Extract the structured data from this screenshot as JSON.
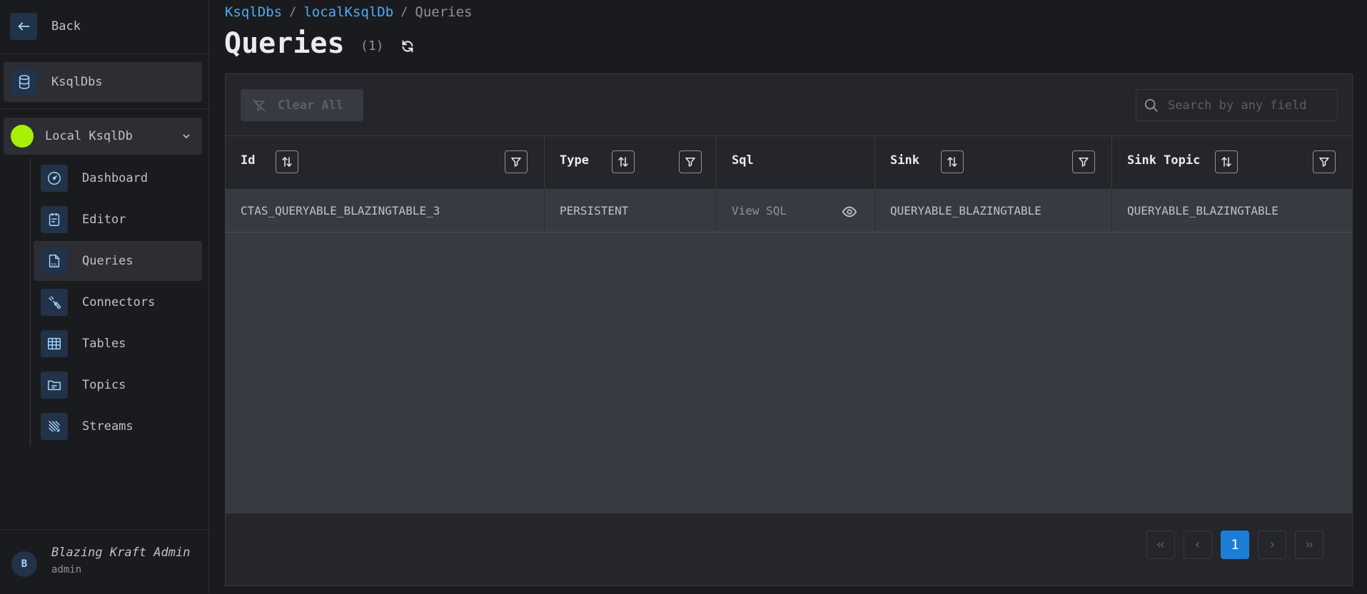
{
  "sidebar": {
    "back_label": "Back",
    "section_label": "KsqlDbs",
    "cluster_name": "Local KsqlDb",
    "cluster_status_color": "#a8ef0a",
    "items": [
      {
        "label": "Dashboard",
        "icon": "dashboard-icon"
      },
      {
        "label": "Editor",
        "icon": "editor-icon"
      },
      {
        "label": "Queries",
        "icon": "sql-file-icon",
        "active": true
      },
      {
        "label": "Connectors",
        "icon": "connectors-icon"
      },
      {
        "label": "Tables",
        "icon": "table-icon"
      },
      {
        "label": "Topics",
        "icon": "topics-icon"
      },
      {
        "label": "Streams",
        "icon": "streams-icon"
      }
    ],
    "user": {
      "initial": "B",
      "name": "Blazing Kraft Admin",
      "role": "admin"
    }
  },
  "breadcrumb": {
    "items": [
      "KsqlDbs",
      "localKsqlDb"
    ],
    "current": "Queries",
    "separator": "/"
  },
  "page": {
    "title": "Queries",
    "count": "(1)"
  },
  "toolbar": {
    "clear_label": "Clear All",
    "search_placeholder": "Search by any field"
  },
  "table": {
    "columns": [
      "Id",
      "Type",
      "Sql",
      "Sink",
      "Sink Topic"
    ],
    "rows": [
      {
        "id": "CTAS_QUERYABLE_BLAZINGTABLE_3",
        "type": "PERSISTENT",
        "sql": "View SQL",
        "sink": "QUERYABLE_BLAZINGTABLE",
        "sink_topic": "QUERYABLE_BLAZINGTABLE"
      }
    ]
  },
  "pagination": {
    "current_page": "1"
  },
  "colors": {
    "accent": "#1c7ed6",
    "link": "#4dabf7",
    "background": "#1a1b1e"
  }
}
